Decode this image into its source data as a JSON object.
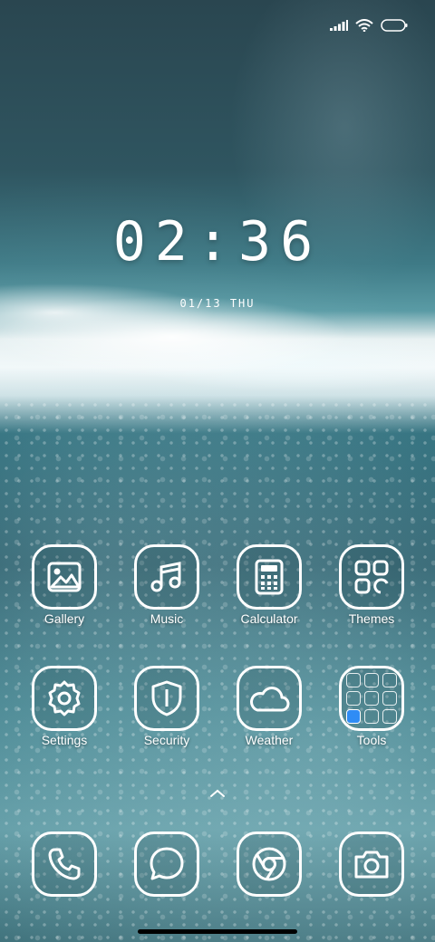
{
  "status_bar": {
    "signal_icon": "signal-bars-icon",
    "wifi_icon": "wifi-icon",
    "battery_icon": "battery-icon"
  },
  "lockscreen": {
    "time": "02:36",
    "date": "01/13 THU"
  },
  "apps": [
    {
      "label": "Gallery",
      "icon": "gallery-icon"
    },
    {
      "label": "Music",
      "icon": "music-note-icon"
    },
    {
      "label": "Calculator",
      "icon": "calculator-icon"
    },
    {
      "label": "Themes",
      "icon": "themes-grid-icon"
    },
    {
      "label": "Settings",
      "icon": "gear-icon"
    },
    {
      "label": "Security",
      "icon": "shield-icon"
    },
    {
      "label": "Weather",
      "icon": "cloud-icon"
    },
    {
      "label": "Tools",
      "icon": "folder-grid-icon"
    }
  ],
  "dock": [
    {
      "icon": "phone-icon"
    },
    {
      "icon": "message-bubble-icon"
    },
    {
      "icon": "browser-icon"
    },
    {
      "icon": "camera-icon"
    }
  ],
  "colors": {
    "icon_outline": "#ffffff",
    "tools_accent": "#2f8cf5"
  }
}
